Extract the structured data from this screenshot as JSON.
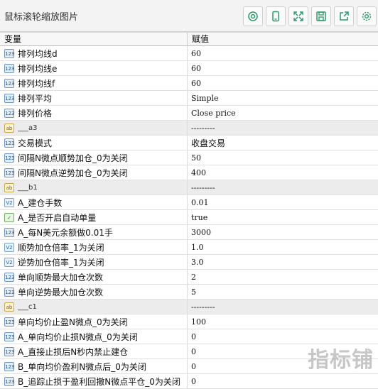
{
  "window": {
    "title": "鼠标滚轮缩放图片"
  },
  "toolbar": {
    "buttons": [
      {
        "name": "zoom-icon"
      },
      {
        "name": "mobile-icon"
      },
      {
        "name": "expand-icon"
      },
      {
        "name": "save-icon"
      },
      {
        "name": "share-icon"
      },
      {
        "name": "settings-icon"
      }
    ]
  },
  "table": {
    "headers": {
      "variable": "变量",
      "value": "赋值"
    },
    "rows": [
      {
        "type": "int",
        "name": "排列均线d",
        "value": "60"
      },
      {
        "type": "int",
        "name": "排列均线e",
        "value": "60"
      },
      {
        "type": "int",
        "name": "排列均线f",
        "value": "60"
      },
      {
        "type": "int",
        "name": "排列平均",
        "value": "Simple"
      },
      {
        "type": "int",
        "name": "排列价格",
        "value": "Close price"
      },
      {
        "type": "str",
        "name": "___a3",
        "value": "---------",
        "group": true
      },
      {
        "type": "int",
        "name": "交易模式",
        "value": "收盘交易"
      },
      {
        "type": "int",
        "name": "间隔N微点顺势加仓_0为关闭",
        "value": "50"
      },
      {
        "type": "int",
        "name": "间隔N微点逆势加仓_0为关闭",
        "value": "400"
      },
      {
        "type": "str",
        "name": "___b1",
        "value": "---------",
        "group": true
      },
      {
        "type": "dbl",
        "name": "A_建仓手数",
        "value": "0.01"
      },
      {
        "type": "bool",
        "name": "A_是否开启自动单量",
        "value": "true"
      },
      {
        "type": "int",
        "name": "A_每N美元余额做0.01手",
        "value": "3000"
      },
      {
        "type": "dbl",
        "name": "顺势加仓倍率_1为关闭",
        "value": "1.0"
      },
      {
        "type": "dbl",
        "name": "逆势加仓倍率_1为关闭",
        "value": "3.0"
      },
      {
        "type": "int",
        "name": "单向顺势最大加仓次数",
        "value": "2"
      },
      {
        "type": "int",
        "name": "单向逆势最大加仓次数",
        "value": "5"
      },
      {
        "type": "str",
        "name": "___c1",
        "value": "---------",
        "group": true
      },
      {
        "type": "int",
        "name": "单向均价止盈N微点_0为关闭",
        "value": "100"
      },
      {
        "type": "int",
        "name": "A_单向均价止损N微点_0为关闭",
        "value": "0"
      },
      {
        "type": "int",
        "name": "A_直接止损后N秒内禁止建仓",
        "value": "0"
      },
      {
        "type": "int",
        "name": "B_单向均价盈利N微点后_0为关闭",
        "value": "0"
      },
      {
        "type": "int",
        "name": "B_追踪止损于盈利回撤N微点平仓_0为关闭",
        "value": "0"
      }
    ]
  },
  "type_labels": {
    "int": "123",
    "dbl": "V2",
    "bool": "✓",
    "str": "ab"
  },
  "watermark": "指标铺"
}
